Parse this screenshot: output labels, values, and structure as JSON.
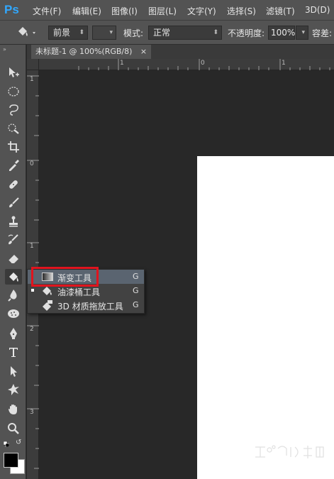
{
  "app": {
    "logo": "Ps"
  },
  "menu": [
    "文件(F)",
    "编辑(E)",
    "图像(I)",
    "图层(L)",
    "文字(Y)",
    "选择(S)",
    "滤镜(T)",
    "3D(D)"
  ],
  "options": {
    "preset_label": "前景",
    "mode_label": "模式:",
    "mode_value": "正常",
    "opacity_label": "不透明度:",
    "opacity_value": "100%",
    "tolerance_label": "容差:"
  },
  "document": {
    "tab_title": "未标题-1 @ 100%(RGB/8)",
    "close": "×"
  },
  "rulers": {
    "top": [
      "1",
      "0",
      "1"
    ],
    "left": [
      "1",
      "0",
      "1",
      "2",
      "3"
    ]
  },
  "flyout": {
    "items": [
      {
        "label": "渐变工具",
        "key": "G",
        "icon": "gradient-icon"
      },
      {
        "label": "油漆桶工具",
        "key": "G",
        "icon": "paint-bucket-icon"
      },
      {
        "label": "3D 材质拖放工具",
        "key": "G",
        "icon": "3d-material-drop-icon"
      }
    ]
  },
  "colors": {
    "accent": "#e0141e",
    "ps_blue": "#31a8ff",
    "panel": "#535353",
    "canvas": "#282828"
  }
}
